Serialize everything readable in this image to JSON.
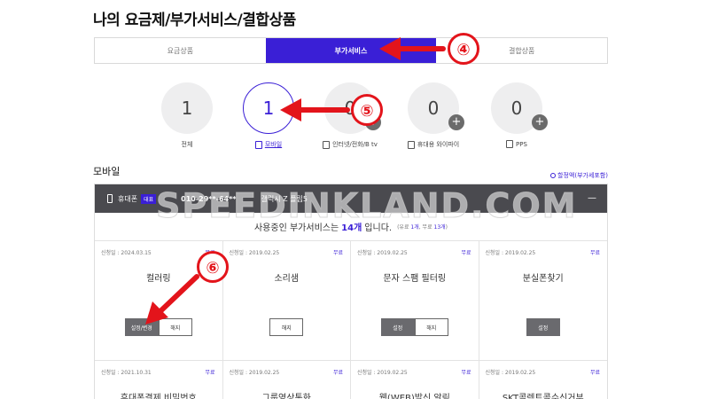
{
  "page": {
    "title": "나의 요금제/부가서비스/결합상품"
  },
  "tabs": [
    {
      "label": "요금상품"
    },
    {
      "label": "부가서비스"
    },
    {
      "label": "결합상품"
    }
  ],
  "counters": [
    {
      "count": "1",
      "label": "전체"
    },
    {
      "count": "1",
      "label": "모바일"
    },
    {
      "count": "0",
      "label": "인터넷/전화/B tv"
    },
    {
      "count": "0",
      "label": "휴대용 와이파이"
    },
    {
      "count": "0",
      "label": "PPS"
    }
  ],
  "section": {
    "title": "모바일",
    "discount_note": "할정액(부가세포함)"
  },
  "device": {
    "type": "휴대폰",
    "badge": "대표",
    "number": "010-29**-64**",
    "plan": "갤럭시 Z 플립5",
    "collapse": "—"
  },
  "summary": {
    "prefix": "사용중인 부가서비스는",
    "count": "14개",
    "suffix": "입니다.",
    "detail_open": "(유료",
    "paid": "1개",
    "comma": ", 무료",
    "free": "13개",
    "detail_close": ")"
  },
  "services": [
    {
      "date": "신청일 : 2024.03.15",
      "fee": "무료",
      "name": "컬러링",
      "buttons": [
        "설정/변경",
        "해지"
      ]
    },
    {
      "date": "신청일 : 2019.02.25",
      "fee": "무료",
      "name": "소리샘",
      "buttons": [
        "해지"
      ]
    },
    {
      "date": "신청일 : 2019.02.25",
      "fee": "무료",
      "name": "문자 스팸 필터링",
      "buttons": [
        "설정",
        "해지"
      ]
    },
    {
      "date": "신청일 : 2019.02.25",
      "fee": "무료",
      "name": "분실폰찾기",
      "buttons": [
        "설정"
      ]
    },
    {
      "date": "신청일 : 2021.10.31",
      "fee": "무료",
      "name": "휴대폰결제 비밀번호",
      "buttons": []
    },
    {
      "date": "신청일 : 2019.02.25",
      "fee": "무료",
      "name": "그룹영상통화",
      "buttons": []
    },
    {
      "date": "신청일 : 2019.02.25",
      "fee": "무료",
      "name": "웹(WEB)발신 알림",
      "buttons": []
    },
    {
      "date": "신청일 : 2019.02.25",
      "fee": "무료",
      "name": "SKT콜렉트콜수신거부",
      "buttons": []
    }
  ],
  "watermark": "SPEEDINKLAND.COM",
  "annotations": [
    {
      "number": "④"
    },
    {
      "number": "⑤"
    },
    {
      "number": "⑥"
    }
  ],
  "colors": {
    "accent": "#3a1fd6",
    "annotation": "#e3141b",
    "header": "#4a4a4f"
  }
}
